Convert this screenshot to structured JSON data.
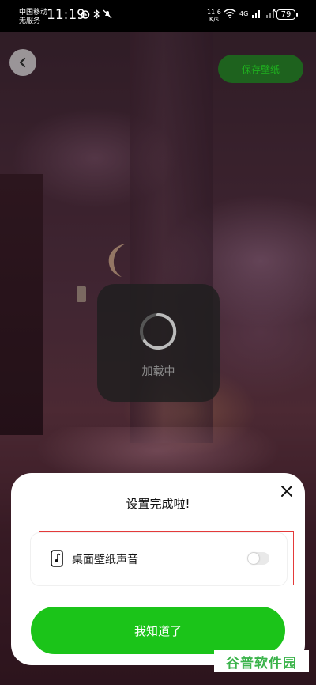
{
  "statusbar": {
    "carrier_line1": "中国移动",
    "carrier_line2": "无服务",
    "time": "11:19",
    "left_icons": [
      "alarm-icon",
      "bluetooth-icon",
      "mute-icon"
    ],
    "net_speed_value": "11.6",
    "net_speed_unit": "K/s",
    "signal_label": "4G",
    "battery": "79"
  },
  "header": {
    "back_icon": "chevron-left-icon",
    "save_label": "保存壁纸"
  },
  "loading": {
    "text": "加载中"
  },
  "sheet": {
    "title": "设置完成啦!",
    "option_icon": "music-note-icon",
    "option_label": "桌面壁纸声音",
    "option_enabled": false,
    "confirm_label": "我知道了",
    "highlight_color": "#e43a3a"
  },
  "colors": {
    "accent": "#1bc419",
    "save_button_bg": "#1c6a1e"
  },
  "watermark": {
    "text": "谷普软件园"
  }
}
